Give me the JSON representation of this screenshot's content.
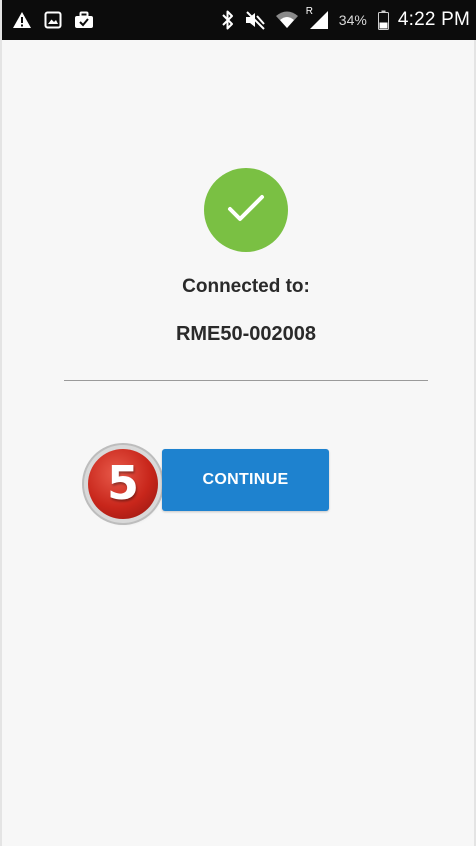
{
  "colors": {
    "status_bar": "#0c0c0c",
    "background": "#f7f7f7",
    "success": "#7ac043",
    "primary_button": "#1e82cf",
    "step_badge": "#c8261b"
  },
  "status_bar": {
    "left_icons": [
      "warning-icon",
      "image-icon",
      "briefcase-icon"
    ],
    "right_icons": [
      "bluetooth-icon",
      "muted-icon",
      "wifi-icon",
      "signal-icon",
      "battery-icon"
    ],
    "signal_badge": "R",
    "battery_percent": "34%",
    "time": "4:22 PM"
  },
  "main": {
    "status_icon": "check-icon",
    "connected_label": "Connected to:",
    "device_name": "RME50-002008",
    "step_number": "5",
    "continue_label": "CONTINUE"
  }
}
